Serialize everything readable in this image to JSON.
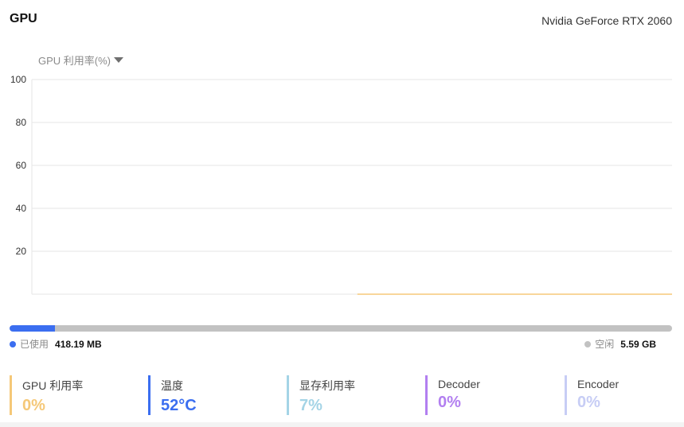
{
  "header": {
    "title": "GPU",
    "gpu_name": "Nvidia GeForce RTX 2060"
  },
  "metric_selector": {
    "label": "GPU 利用率(%)",
    "icon": "caret-down-icon"
  },
  "chart_data": {
    "type": "line",
    "y_ticks": [
      "100",
      "80",
      "60",
      "40",
      "20"
    ],
    "ylim": [
      0,
      100
    ],
    "grid": true,
    "line_color": "#f5c878",
    "series": [
      {
        "values": [
          0,
          0,
          0,
          0,
          0,
          0,
          0,
          0,
          0,
          0,
          0,
          0,
          0,
          0,
          0,
          0,
          0,
          0,
          0,
          0,
          0,
          0,
          0,
          0,
          0,
          0,
          0,
          0,
          0,
          0
        ]
      }
    ],
    "total_points": 60
  },
  "memory": {
    "used_fraction": 0.0685,
    "used_label": "已使用",
    "used_value": "418.19 MB",
    "free_label": "空闲",
    "free_value": "5.59 GB",
    "used_color": "#3b6ef0",
    "free_color": "#c2c2c2"
  },
  "stats": [
    {
      "label": "GPU 利用率",
      "value": "0%",
      "color": "#f5c878"
    },
    {
      "label": "温度",
      "value": "52°C",
      "color": "#3b6ef0"
    },
    {
      "label": "显存利用率",
      "value": "7%",
      "color": "#a4d4e6"
    },
    {
      "label": "Decoder",
      "value": "0%",
      "color": "#b27ff0"
    },
    {
      "label": "Encoder",
      "value": "0%",
      "color": "#c7cdf5"
    }
  ]
}
